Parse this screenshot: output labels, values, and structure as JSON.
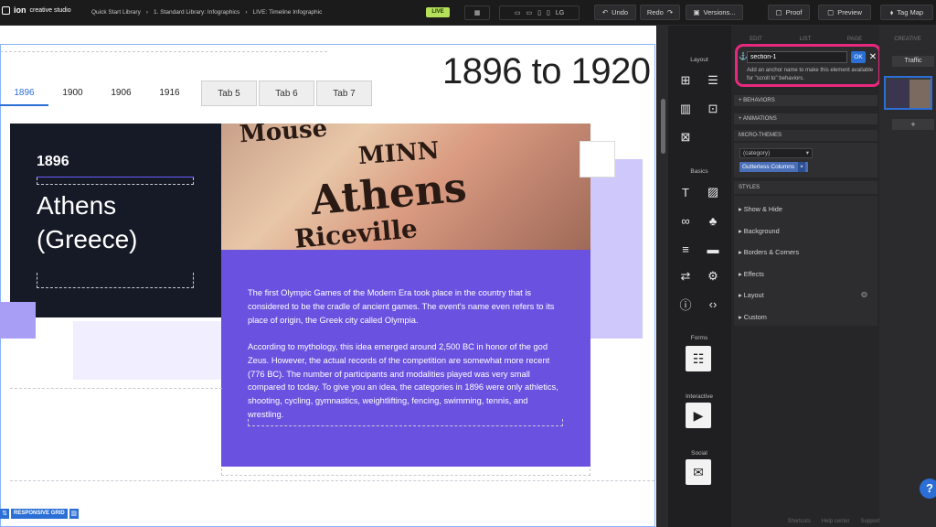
{
  "topbar": {
    "logo_brand": "ion",
    "logo_sub": "creative studio",
    "breadcrumbs": [
      "Quick Start Library",
      "›",
      "1. Standard Library: Infographics",
      "›",
      "LIVE: Timeline Infographic"
    ],
    "live_badge": "LIVE",
    "device_label": "LG",
    "undo": "Undo",
    "redo": "Redo",
    "versions": "Versions...",
    "proof": "Proof",
    "preview": "Preview",
    "tag_map": "Tag Map"
  },
  "canvas": {
    "headline": "1896 to 1920",
    "tabs": [
      "1896",
      "1900",
      "1906",
      "1916",
      "Tab 5",
      "Tab 6",
      "Tab 7"
    ],
    "active_tab": "1896",
    "year": "1896",
    "city_line1": "Athens",
    "city_line2": "(Greece)",
    "paragraph1": "The first Olympic Games of the Modern Era took place in the country that is considered to be the cradle of ancient games. The event's name even refers to its place of origin, the Greek city called Olympia.",
    "paragraph2": "According to mythology, this idea emerged around 2,500 BC in honor of the god Zeus. However, the actual records of the competition are somewhat more recent (776 BC). The number of participants and modalities played was very small compared to today. To give you an idea, the categories in 1896 were only athletics, shooting, cycling, gymnastics, weightlifting, fencing, swimming, tennis, and wrestling.",
    "responsive_grid": "RESPONSIVE GRID",
    "photo_words": [
      "Mouse",
      "MINN",
      "Athens",
      "Riceville"
    ]
  },
  "widgets": {
    "layout_label": "Layout",
    "basics_label": "Basics",
    "forms_label": "Forms",
    "interactive_label": "Interactive",
    "social_label": "Social"
  },
  "properties": {
    "tabs": [
      "EDIT",
      "LIST",
      "PAGE"
    ],
    "anchor_value": "section-1",
    "ok": "OK",
    "anchor_help": "Add an anchor name to make this element available for \"scroll to\" behaviors.",
    "behaviors": "+ BEHAVIORS",
    "animations": "+ ANIMATIONS",
    "micro_themes": "MICRO-THEMES",
    "category_placeholder": "(category)",
    "theme_tag": "Gutterless Columns",
    "styles": "STYLES",
    "style_items": [
      "Show & Hide",
      "Background",
      "Borders & Corners",
      "Effects",
      "Layout",
      "Custom"
    ]
  },
  "creative": {
    "label": "CREATIVE",
    "traffic": "Traffic",
    "add": "+"
  },
  "footer": {
    "items": [
      "Shortcuts",
      "Help center",
      "Support"
    ]
  },
  "colors": {
    "accent_purple": "#6b51e0",
    "dark_panel": "#161a26",
    "highlight_pink": "#e8287f",
    "blue": "#2b6fd6",
    "live_green": "#b6e05a"
  }
}
